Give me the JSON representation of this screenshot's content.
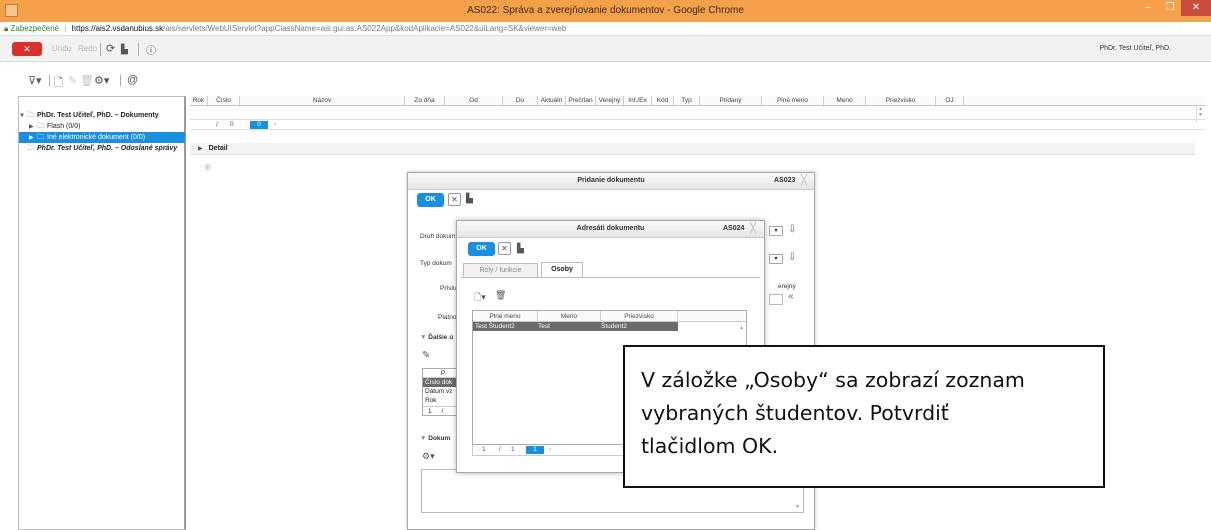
{
  "window": {
    "title": "AS022: Správa a zverejňovanie dokumentov - Google Chrome",
    "buttons": [
      "–",
      "❐",
      "✕"
    ]
  },
  "address": {
    "secure_label": "Zabezpečené",
    "host": "https://ais2.vsdanubius.sk",
    "path": "/ais/servlets/WebUIServlet?appClassName=ais.gui.as.AS022App&kodAplikacie=AS022&uiLang=SK&viewer=web"
  },
  "app_toolbar": {
    "close_label": "✕",
    "undo_label": "Undo",
    "redo_label": "Redo",
    "user_name": "PhDr. Test Učiteľ, PhD."
  },
  "tree": {
    "items": [
      {
        "label": "PhDr. Test Učiteľ, PhD. – Dokumenty",
        "expanded": true
      },
      {
        "label": "Flash (0/0)"
      },
      {
        "label": "Iné elektronické dokument (0/0)",
        "selected": true
      },
      {
        "label": "PhDr. Test Učiteľ, PhD. – Odoslané správy"
      }
    ]
  },
  "main_table": {
    "columns": [
      "Rok",
      "Číslo",
      "Názov",
      "Zo dňa",
      "Od",
      "Do",
      "Aktuáln",
      "Prečítan",
      "Verejný",
      "Int./Ex",
      "Kód",
      "Typ",
      "Pridaný",
      "Plné meno",
      "Meno",
      "Priezvisko",
      "OJ"
    ],
    "pager": {
      "sep": "/",
      "total": "0",
      "current": "0"
    },
    "detail_label": "Detail"
  },
  "dialog1": {
    "title": "Pridanie dokumentu",
    "code": "AS023",
    "ok_label": "OK",
    "fields": {
      "druh": "Druh dokum",
      "typ": "Typ dokum",
      "prislus": "Prísluš",
      "platnost": "Platno",
      "verejny": "erejný",
      "dalsie": "Ďalšie ú",
      "dokum": "Dokum"
    },
    "mini_table": {
      "header": "P",
      "rows": [
        "Číslo dok",
        "Dátum vz",
        "Rok"
      ],
      "pager": {
        "current": "1",
        "sep": "/"
      }
    }
  },
  "dialog2": {
    "title": "Adresáti dokumentu",
    "code": "AS024",
    "ok_label": "OK",
    "tabs": [
      {
        "label": "Roly / funkcie",
        "active": false
      },
      {
        "label": "Osoby",
        "active": true
      }
    ],
    "grid": {
      "columns": [
        "Plné meno",
        "Meno",
        "Priezvisko"
      ],
      "rows": [
        {
          "full_name": "Test Študent2",
          "first_name": "Test",
          "last_name": "Študent2"
        }
      ],
      "pager": {
        "current": "1",
        "sep": "/",
        "total": "1",
        "page": "1"
      }
    }
  },
  "callout": {
    "line1": "V záložke „Osoby“ sa zobrazí zoznam",
    "line2": "vybraných študentov. Potvrdiť",
    "line3": "tlačidlom OK."
  },
  "colors": {
    "titlebar": "#f5a04a",
    "accent": "#1a8fe0",
    "close_red": "#d8312c",
    "selected_row": "#6b6b6b"
  }
}
